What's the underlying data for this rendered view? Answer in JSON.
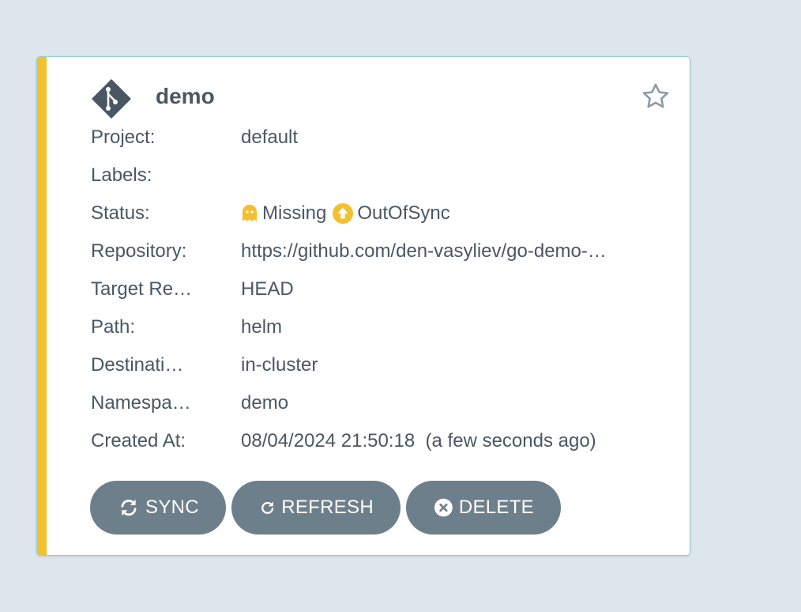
{
  "app": {
    "name": "demo",
    "status_color": "#f4c030",
    "icon": "git-branch-diamond-icon",
    "favorite_icon": "star-outline-icon"
  },
  "fields": {
    "project": {
      "label": "Project:",
      "value": "default"
    },
    "labels": {
      "label": "Labels:",
      "value": ""
    },
    "status": {
      "label": "Status:",
      "health": {
        "text": "Missing",
        "icon": "ghost-icon",
        "color": "#f4c030"
      },
      "sync": {
        "text": "OutOfSync",
        "icon": "arrow-up-circle-icon",
        "color": "#f4c030"
      }
    },
    "repository": {
      "label": "Repository:",
      "value": "https://github.com/den-vasyliev/go-demo-…"
    },
    "target_revision": {
      "label": "Target Re…",
      "value": "HEAD"
    },
    "path": {
      "label": "Path:",
      "value": "helm"
    },
    "destination": {
      "label": "Destinati…",
      "value": "in-cluster"
    },
    "namespace": {
      "label": "Namespa…",
      "value": "demo"
    },
    "created_at": {
      "label": "Created At:",
      "value": "08/04/2024 21:50:18  (a few seconds ago)"
    }
  },
  "actions": {
    "sync": {
      "label": "SYNC",
      "icon": "sync-icon"
    },
    "refresh": {
      "label": "REFRESH",
      "icon": "refresh-icon"
    },
    "delete": {
      "label": "DELETE",
      "icon": "close-circle-icon"
    }
  }
}
